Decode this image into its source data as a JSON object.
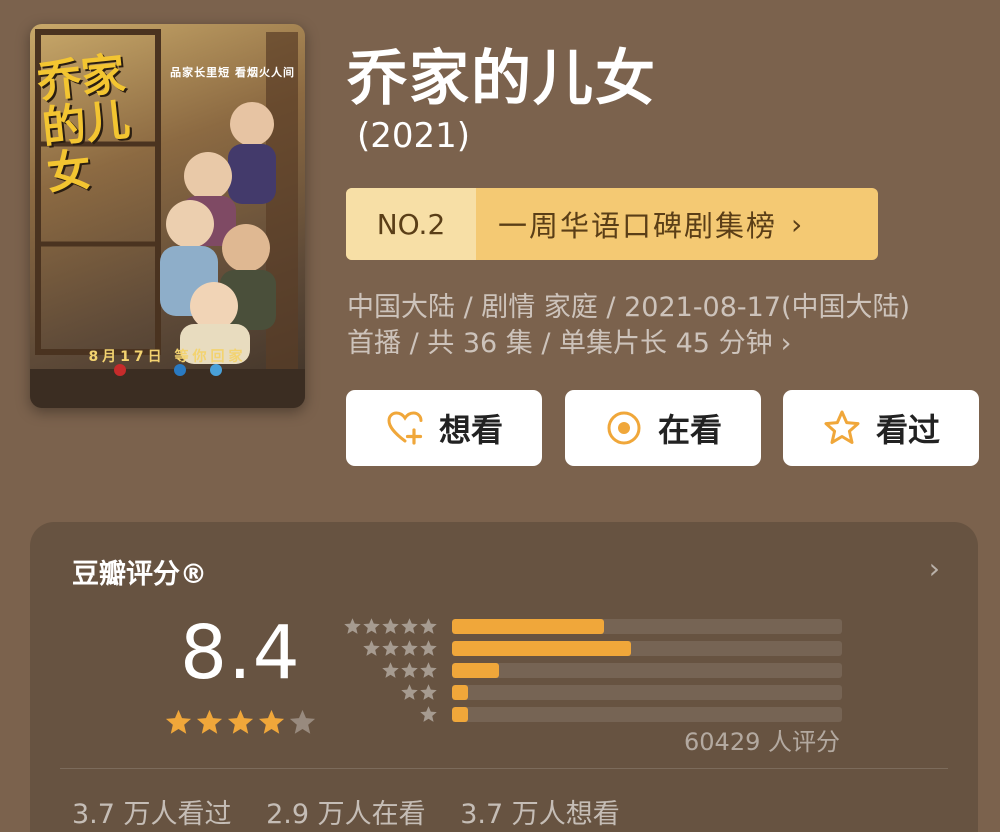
{
  "show": {
    "title": "乔家的儿女",
    "year": "(2021)",
    "poster": {
      "title_art": "乔家的儿女",
      "slogan": "品家长里短  看烟火人间",
      "date_text": "8月17日  等你回家"
    }
  },
  "ranking": {
    "number": "NO.2",
    "label": "一周华语口碑剧集榜",
    "chevron": "›"
  },
  "meta": {
    "line1": "中国大陆 / 剧情 家庭 / 2021-08-17(中国大陆)",
    "line2": "首播 / 共 36 集 / 单集片长 45 分钟",
    "chevron": "›"
  },
  "actions": {
    "want_label": "想看",
    "watching_label": "在看",
    "watched_label": "看过"
  },
  "rating": {
    "title": "豆瓣评分®",
    "chevron": "›",
    "score": "8.4",
    "star_level": 4,
    "distribution_fractions": [
      0.39,
      0.46,
      0.12,
      0.04,
      0.04
    ],
    "count_text": "60429 人评分"
  },
  "stats": {
    "watched": "3.7 万人看过",
    "watching": "2.9 万人在看",
    "want": "3.7 万人想看"
  },
  "colors": {
    "background": "#7b624d",
    "card": "#675341",
    "accent": "#f0a73a",
    "badge_light": "#f7dfa6",
    "badge": "#f4c973"
  },
  "icons": {
    "want": "heart-plus-icon",
    "watching": "target-icon",
    "watched": "star-outline-icon"
  }
}
